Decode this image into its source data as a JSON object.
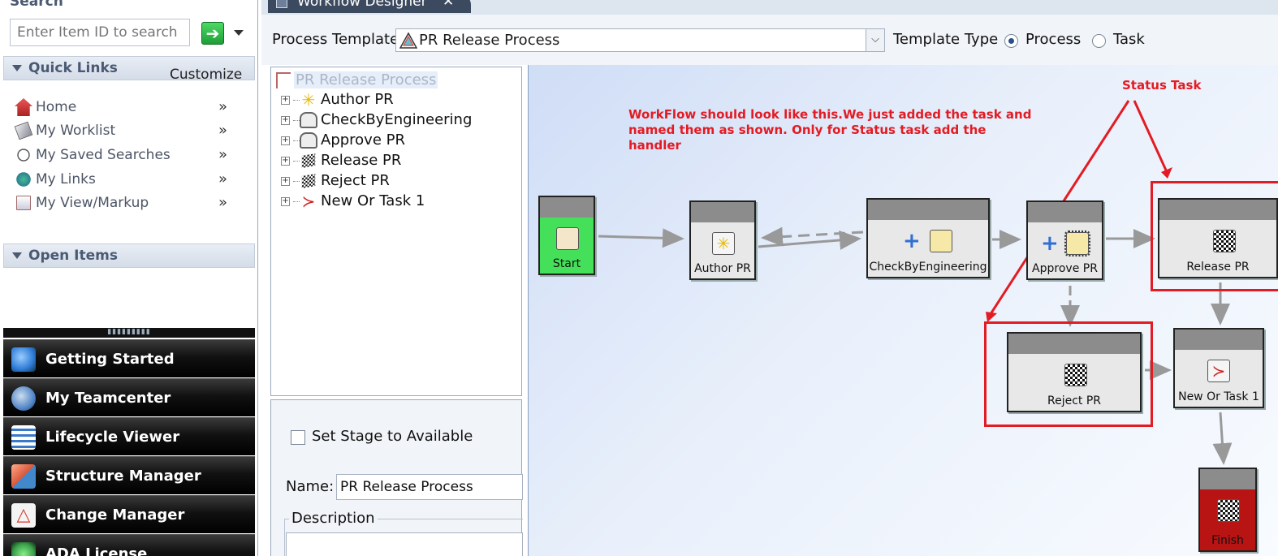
{
  "left_panel": {
    "search": {
      "header": "Search",
      "placeholder": "Enter Item ID to search"
    },
    "quick_links": {
      "header": "Quick Links",
      "customize": "Customize",
      "items": [
        {
          "label": "Home",
          "icon": "home-icon"
        },
        {
          "label": "My Worklist",
          "icon": "worklist-icon"
        },
        {
          "label": "My Saved Searches",
          "icon": "saved-search-icon"
        },
        {
          "label": "My Links",
          "icon": "links-icon"
        },
        {
          "label": "My View/Markup",
          "icon": "markup-icon"
        }
      ],
      "chevron": "»"
    },
    "open_items": {
      "header": "Open Items"
    },
    "nav_buttons": [
      {
        "label": "Getting Started",
        "icon": "getting-started-icon",
        "color": "#2e7bd6"
      },
      {
        "label": "My Teamcenter",
        "icon": "globe-icon",
        "color": "#4a7fc4"
      },
      {
        "label": "Lifecycle Viewer",
        "icon": "lifecycle-icon",
        "color": "#3a78c8"
      },
      {
        "label": "Structure Manager",
        "icon": "structure-icon",
        "color": "#d9563a"
      },
      {
        "label": "Change Manager",
        "icon": "change-icon",
        "color": "#d93a2f"
      },
      {
        "label": "ADA License",
        "icon": "license-icon",
        "color": "#3aa04a"
      }
    ]
  },
  "editor": {
    "tab_title": "Workflow Designer",
    "tab_close": "✕",
    "process_template_label": "Process Template",
    "process_template_value": "PR Release Process",
    "template_type_label": "Template Type",
    "template_type_options": [
      "Process",
      "Task"
    ],
    "template_type_selected": "Process"
  },
  "tree": {
    "root": "PR Release Process",
    "children": [
      {
        "label": "Author PR",
        "icon": "do-task-icon"
      },
      {
        "label": "CheckByEngineering",
        "icon": "review-task-icon"
      },
      {
        "label": "Approve PR",
        "icon": "review-task-icon"
      },
      {
        "label": "Release PR",
        "icon": "status-task-icon"
      },
      {
        "label": "Reject PR",
        "icon": "status-task-icon"
      },
      {
        "label": "New Or Task 1",
        "icon": "or-task-icon"
      }
    ]
  },
  "properties": {
    "set_stage_label": "Set Stage to Available",
    "set_stage_checked": false,
    "name_label": "Name:",
    "name_value": "PR Release Process",
    "description_label": "Description"
  },
  "workflow": {
    "nodes": [
      {
        "id": "start",
        "label": "Start"
      },
      {
        "id": "author",
        "label": "Author PR"
      },
      {
        "id": "check",
        "label": "CheckByEngineering"
      },
      {
        "id": "approve",
        "label": "Approve PR"
      },
      {
        "id": "release",
        "label": "Release PR"
      },
      {
        "id": "reject",
        "label": "Reject PR"
      },
      {
        "id": "ortask",
        "label": "New Or Task 1"
      },
      {
        "id": "finish",
        "label": "Finish"
      }
    ],
    "annotation_note": "WorkFlow should look like this.We just added the task and named them as shown. Only for Status task add the handler",
    "annotation_status": "Status Task",
    "annotation_color": "#e31b23",
    "start_color": "#44e05a",
    "finish_color": "#b81414"
  }
}
